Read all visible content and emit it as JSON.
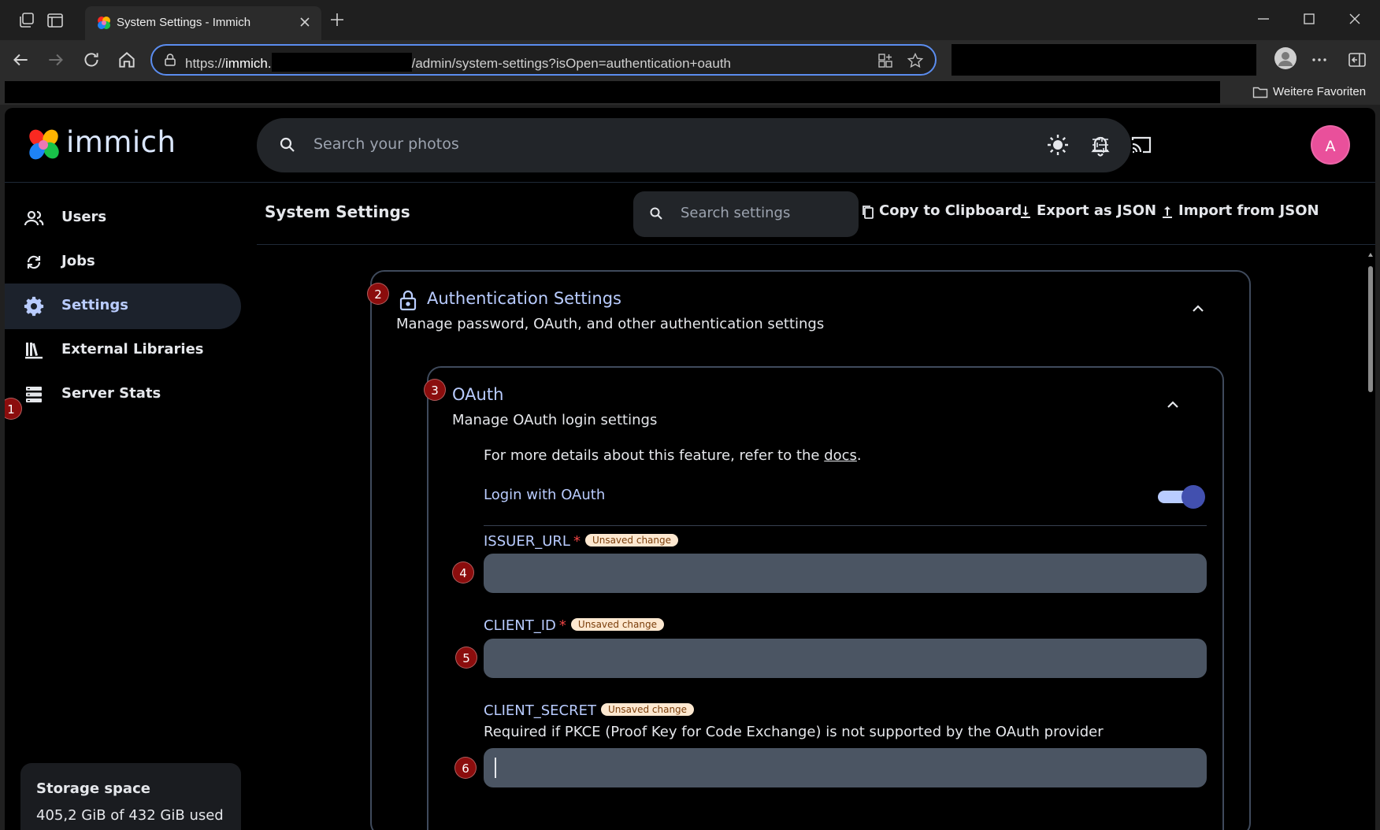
{
  "browser": {
    "tab_title": "System Settings - Immich",
    "url_prefix": "https://",
    "url_host": "immich.",
    "url_path": "/admin/system-settings?isOpen=authentication+oauth",
    "bookmark_folder": "Weitere Favoriten"
  },
  "app": {
    "logo_text": "immich",
    "search_placeholder": "Search your photos",
    "avatar_letter": "A"
  },
  "sidebar": {
    "items": [
      {
        "label": "Users",
        "icon": "users-icon"
      },
      {
        "label": "Jobs",
        "icon": "sync-icon"
      },
      {
        "label": "Settings",
        "icon": "gear-icon",
        "active": true
      },
      {
        "label": "External Libraries",
        "icon": "library-icon"
      },
      {
        "label": "Server Stats",
        "icon": "server-icon"
      }
    ],
    "storage_title": "Storage space",
    "storage_used": "405,2 GiB of 432 GiB used"
  },
  "toolbar": {
    "title": "System Settings",
    "search_placeholder": "Search settings",
    "copy_label": "Copy to Clipboard",
    "export_label": "Export as JSON",
    "import_label": "Import from JSON"
  },
  "auth": {
    "title": "Authentication Settings",
    "description": "Manage password, OAuth, and other authentication settings"
  },
  "oauth": {
    "title": "OAuth",
    "description": "Manage OAuth login settings",
    "details_prefix": "For more details about this feature, refer to the ",
    "details_link": "docs",
    "details_suffix": ".",
    "toggle_label": "Login with OAuth",
    "toggle_on": true,
    "fields": [
      {
        "label": "ISSUER_URL",
        "required": "*",
        "badge": "Unsaved change",
        "value": ""
      },
      {
        "label": "CLIENT_ID",
        "required": "*",
        "badge": "Unsaved change",
        "value": ""
      },
      {
        "label": "CLIENT_SECRET",
        "badge": "Unsaved change",
        "hint": "Required if PKCE (Proof Key for Code Exchange) is not supported by the OAuth provider",
        "value": ""
      }
    ]
  },
  "annotations": [
    "1",
    "2",
    "3",
    "4",
    "5",
    "6"
  ],
  "colors": {
    "accent": "#b9ccff",
    "annotation_badge": "#8b0d0d",
    "toggle_knob": "#4250af",
    "avatar": "#e9509b"
  }
}
